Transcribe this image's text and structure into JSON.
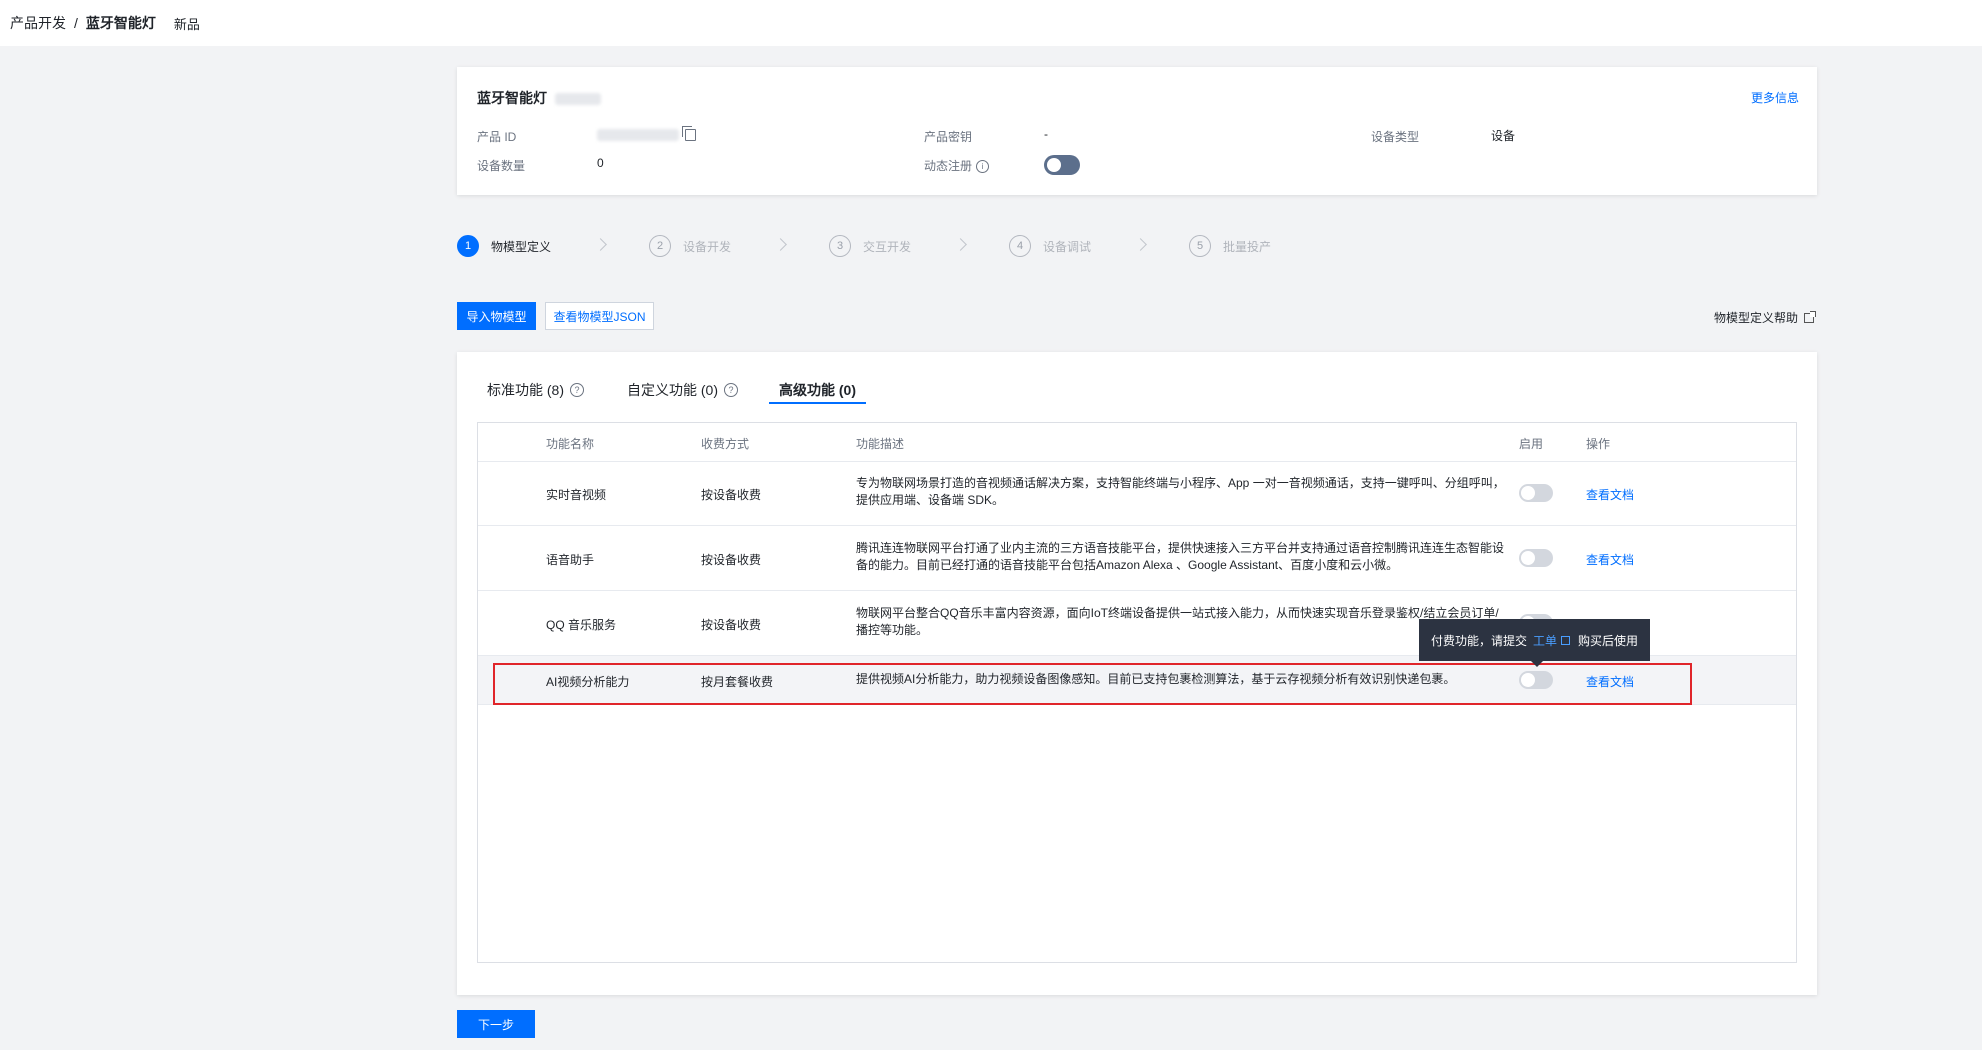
{
  "breadcrumb": {
    "root": "产品开发",
    "separator": "/",
    "current": "蓝牙智能灯",
    "tag": "新品"
  },
  "product": {
    "name": "蓝牙智能灯",
    "more_link": "更多信息",
    "product_id_label": "产品 ID",
    "product_key_label": "产品密钥",
    "product_key_value": "-",
    "device_type_label": "设备类型",
    "device_type_value": "设备",
    "device_count_label": "设备数量",
    "device_count_value": "0",
    "dynamic_register_label": "动态注册",
    "dynamic_register_on": false
  },
  "steps": [
    {
      "num": "1",
      "label": "物模型定义",
      "active": true
    },
    {
      "num": "2",
      "label": "设备开发",
      "active": false
    },
    {
      "num": "3",
      "label": "交互开发",
      "active": false
    },
    {
      "num": "4",
      "label": "设备调试",
      "active": false
    },
    {
      "num": "5",
      "label": "批量投产",
      "active": false
    }
  ],
  "actions": {
    "import_label": "导入物模型",
    "view_json_label": "查看物模型JSON",
    "help_label": "物模型定义帮助"
  },
  "tabs": [
    {
      "label": "标准功能 (8)",
      "help": true,
      "active": false
    },
    {
      "label": "自定义功能 (0)",
      "help": true,
      "active": false
    },
    {
      "label": "高级功能 (0)",
      "help": false,
      "active": true
    }
  ],
  "table": {
    "headers": {
      "name": "功能名称",
      "billing": "收费方式",
      "desc": "功能描述",
      "enable": "启用",
      "action": "操作"
    },
    "rows": [
      {
        "name": "实时音视频",
        "billing": "按设备收费",
        "desc": "专为物联网场景打造的音视频通话解决方案，支持智能终端与小程序、App 一对一音视频通话，支持一键呼叫、分组呼叫，提供应用端、设备端 SDK。",
        "enabled": false,
        "action": "查看文档"
      },
      {
        "name": "语音助手",
        "billing": "按设备收费",
        "desc": "腾讯连连物联网平台打通了业内主流的三方语音技能平台，提供快速接入三方平台并支持通过语音控制腾讯连连生态智能设备的能力。目前已经打通的语音技能平台包括Amazon Alexa 、Google Assistant、百度小度和云小微。",
        "enabled": false,
        "action": "查看文档"
      },
      {
        "name": "QQ 音乐服务",
        "billing": "按设备收费",
        "desc": "物联网平台整合QQ音乐丰富内容资源，面向IoT终端设备提供一站式接入能力，从而快速实现音乐登录鉴权/结立会员订单/播控等功能。",
        "enabled": false,
        "action": ""
      },
      {
        "name": "AI视频分析能力",
        "billing": "按月套餐收费",
        "desc": "提供视频AI分析能力，助力视频设备图像感知。目前已支持包裹检测算法，基于云存视频分析有效识别快递包裹。",
        "enabled": false,
        "action": "查看文档"
      }
    ]
  },
  "tooltip": {
    "prefix": "付费功能，请提交",
    "link": "工单",
    "suffix": "购买后使用"
  },
  "footer": {
    "next_label": "下一步"
  },
  "colors": {
    "primary": "#006eff",
    "highlight_border": "#e0252a",
    "tooltip_bg": "#2c3341"
  }
}
